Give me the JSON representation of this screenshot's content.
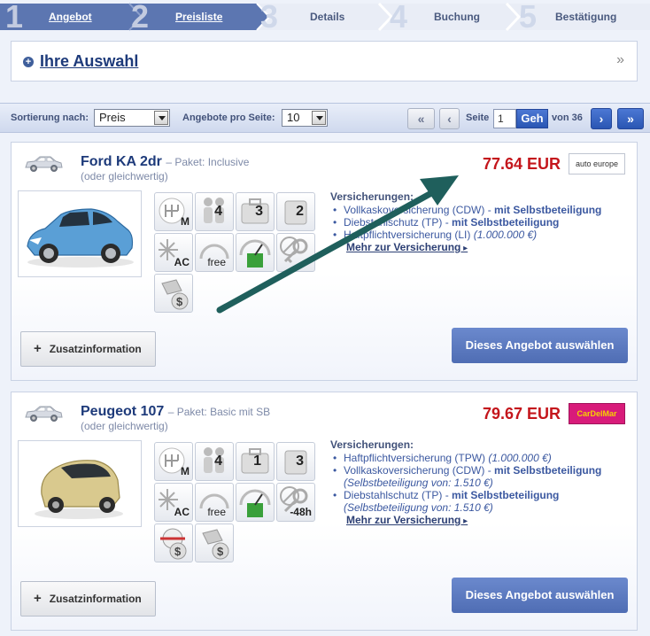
{
  "steps": [
    {
      "num": "1",
      "label": "Angebot",
      "state": "active"
    },
    {
      "num": "2",
      "label": "Preisliste",
      "state": "active"
    },
    {
      "num": "3",
      "label": "Details",
      "state": "todo"
    },
    {
      "num": "4",
      "label": "Buchung",
      "state": "todo"
    },
    {
      "num": "5",
      "label": "Bestätigung",
      "state": "todo"
    }
  ],
  "selection": {
    "title": "Ihre Auswahl",
    "expand_icon": "double-chevron-right-icon"
  },
  "toolbar": {
    "sort_label": "Sortierung nach:",
    "sort_value": "Preis",
    "per_page_label": "Angebote pro Seite:",
    "per_page_value": "10",
    "first_label": "«",
    "prev_label": "‹",
    "next_label": "›",
    "last_label": "»",
    "page_label": "Seite",
    "page_value": "1",
    "go_label": "Geh",
    "total_label": "von 36"
  },
  "offers": [
    {
      "name": "Ford KA 2dr",
      "paket_label": "– Paket:",
      "paket_value": "Inclusive",
      "similar": "(oder gleichwertig)",
      "price": "77.64 EUR",
      "partner": "auto europe",
      "features": {
        "doors": "4",
        "luggage_large": "3",
        "luggage_small": "2"
      },
      "insurance_title": "Versicherungen:",
      "insurance": [
        {
          "text": "Vollkaskoversicherung (CDW) - ",
          "bold": "mit Selbstbeteiligung",
          "note": ""
        },
        {
          "text": "Diebstahlschutz (TP) - ",
          "bold": "mit Selbstbeteiligung",
          "note": ""
        },
        {
          "text": "Haftpflichtversicherung (LI) ",
          "bold": "",
          "note": "(1.000.000 €)"
        }
      ],
      "insurance_more": "Mehr zur Versicherung",
      "info_button": "Zusatzinformation",
      "select_button": "Dieses Angebot auswählen"
    },
    {
      "name": "Peugeot 107",
      "paket_label": "– Paket:",
      "paket_value": "Basic mit SB",
      "similar": "(oder gleichwertig)",
      "price": "79.67 EUR",
      "partner": "CarDelMar",
      "features": {
        "doors": "4",
        "luggage_large": "1",
        "luggage_small": "3",
        "key_hours": "-48h"
      },
      "insurance_title": "Versicherungen:",
      "insurance": [
        {
          "text": "Haftpflichtversicherung (TPW) ",
          "bold": "",
          "note": "(1.000.000 €)"
        },
        {
          "text": "Vollkaskoversicherung (CDW) - ",
          "bold": "mit Selbstbeteiligung",
          "note": "(Selbstbeteiligung von: 1.510 €)"
        },
        {
          "text": "Diebstahlschutz (TP) - ",
          "bold": "mit Selbstbeteiligung",
          "note": "(Selbstbeteiligung von: 1.510 €)"
        }
      ],
      "insurance_more": "Mehr zur Versicherung",
      "info_button": "Zusatzinformation",
      "select_button": "Dieses Angebot auswählen"
    }
  ],
  "feature_labels": {
    "ac": "AC",
    "free": "free",
    "manual": "M"
  },
  "colors": {
    "brand_blue": "#1d3a7a",
    "price_red": "#c4161c",
    "button_blue": "#5a78c0",
    "steps_active": "#5a74b0",
    "annotation_arrow": "#1f5f5c"
  }
}
